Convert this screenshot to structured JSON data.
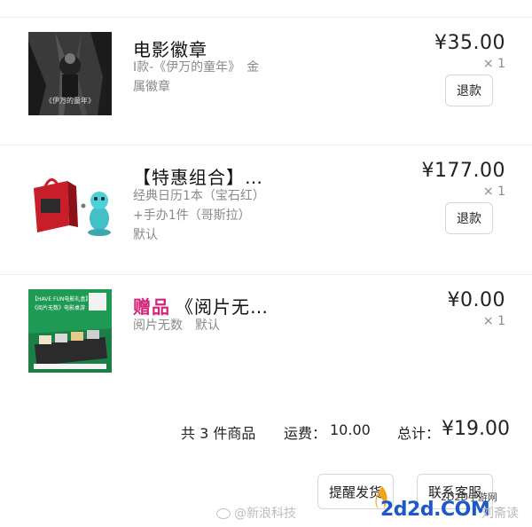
{
  "items": [
    {
      "title": "电影徽章",
      "spec_lines": [
        "I款-《伊万的童年》　金",
        "属徽章"
      ],
      "price": "¥35.00",
      "qty": "× 1",
      "refund_label": "退款",
      "thumb_caption": "《伊万的童年》"
    },
    {
      "title": "【特惠组合】…",
      "spec_lines": [
        "经典日历1本（宝石红）",
        "+手办1件（哥斯拉）",
        "默认"
      ],
      "price": "¥177.00",
      "qty": "× 1",
      "refund_label": "退款"
    },
    {
      "gift_tag": "赠品",
      "title": "《阅片无…",
      "spec_lines": [
        "阅片无数　默认"
      ],
      "price": "¥0.00",
      "qty": "× 1",
      "thumb_caption_1": "【HAVE FUN电影礼盒】",
      "thumb_caption_2": "《阅片无数》电影桌游"
    }
  ],
  "summary": {
    "count_text": "共 3 件商品",
    "shipping_label": "运费：",
    "shipping_value": "10.00",
    "total_label": "总计：",
    "total_value": "¥19.00"
  },
  "footer": {
    "remind_label": "提醒发货",
    "contact_label": "联系客服"
  },
  "watermarks": {
    "weibo": "@新浪科技",
    "site_big": "2d2d.COM",
    "site_small": "2D2D手游网",
    "ghost": "刘斋读"
  },
  "colors": {
    "gift_tag": "#d4237a",
    "site_logo": "#1c58c9"
  }
}
